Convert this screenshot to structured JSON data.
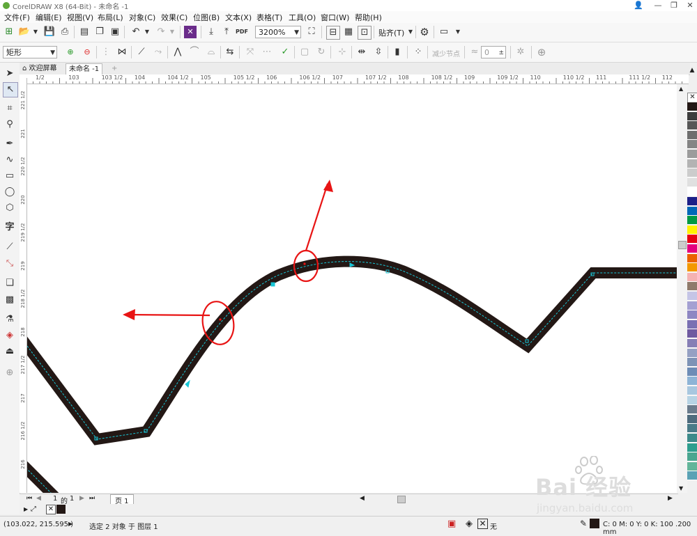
{
  "window": {
    "title": "CorelDRAW X8 (64-Bit) - 未命名 -1",
    "controls": [
      "👤",
      "—",
      "❐",
      "✕"
    ]
  },
  "menu": [
    "文件(F)",
    "编辑(E)",
    "视图(V)",
    "布局(L)",
    "对象(C)",
    "效果(C)",
    "位图(B)",
    "文本(X)",
    "表格(T)",
    "工具(O)",
    "窗口(W)",
    "帮助(H)"
  ],
  "toolbar1": {
    "zoom_value": "3200%",
    "snap_label": "贴齐(T)",
    "pdf_label": "PDF"
  },
  "toolbar2": {
    "shape_select": "矩形",
    "reduce_nodes_label": "减少节点",
    "curve_smoothness_value": "0"
  },
  "tabs": {
    "welcome": "欢迎屏幕",
    "document": "未命名 -1",
    "add": "+"
  },
  "hruler": {
    "labels": [
      "1/2",
      "103",
      "103 1/2",
      "104",
      "104 1/2",
      "105",
      "105 1/2",
      "106",
      "106 1/2",
      "107",
      "107 1/2",
      "108",
      "108 1/2",
      "109",
      "109 1/2",
      "110",
      "110 1/2",
      "111",
      "111 1/2",
      "112"
    ]
  },
  "vruler": {
    "labels": [
      "221 1/2",
      "221",
      "220 1/2",
      "220",
      "219 1/2",
      "219",
      "218 1/2",
      "218",
      "217 1/2",
      "217",
      "216 1/2",
      "216"
    ]
  },
  "pagenav": {
    "current": "1",
    "of_label": "的",
    "total": "1",
    "page_tab": "页 1"
  },
  "status": {
    "coords": "(103.022, 215.595 )",
    "selection": "选定 2 对象 于 图层 1",
    "fill_none": "无",
    "outline": "C: 0 M: 0 Y: 0 K: 100  .200 mm"
  },
  "watermark": {
    "brand": "Bai 经验",
    "url": "jingyan.baidu.com"
  },
  "colors": {
    "path": "#231815",
    "node_line": "#18c6d6",
    "annotation": "#e81414",
    "palette": [
      "#231815",
      "#3d3d3d",
      "#575757",
      "#6e6e6e",
      "#858585",
      "#9c9c9c",
      "#b3b3b3",
      "#cccccc",
      "#e0e0e0",
      "#ffffff",
      "#1d2088",
      "#0068b7",
      "#009944",
      "#fff100",
      "#e60012",
      "#e4007f",
      "#eb6100",
      "#f39800",
      "#f5b2b2",
      "#8f7a6b",
      "#c5c5e6",
      "#a4a0d2",
      "#8e87c3",
      "#7a70b3",
      "#6f5aa0",
      "#867eb5",
      "#95a0c3",
      "#7e93b6",
      "#6d8cb6",
      "#8eb4d6",
      "#a8c7df",
      "#b7d3e4",
      "#6a7b8c",
      "#4e6b7d",
      "#4a7b88",
      "#3d8a8a",
      "#2e9e8e",
      "#4aa690",
      "#63b59a",
      "#5aa2b5"
    ]
  }
}
